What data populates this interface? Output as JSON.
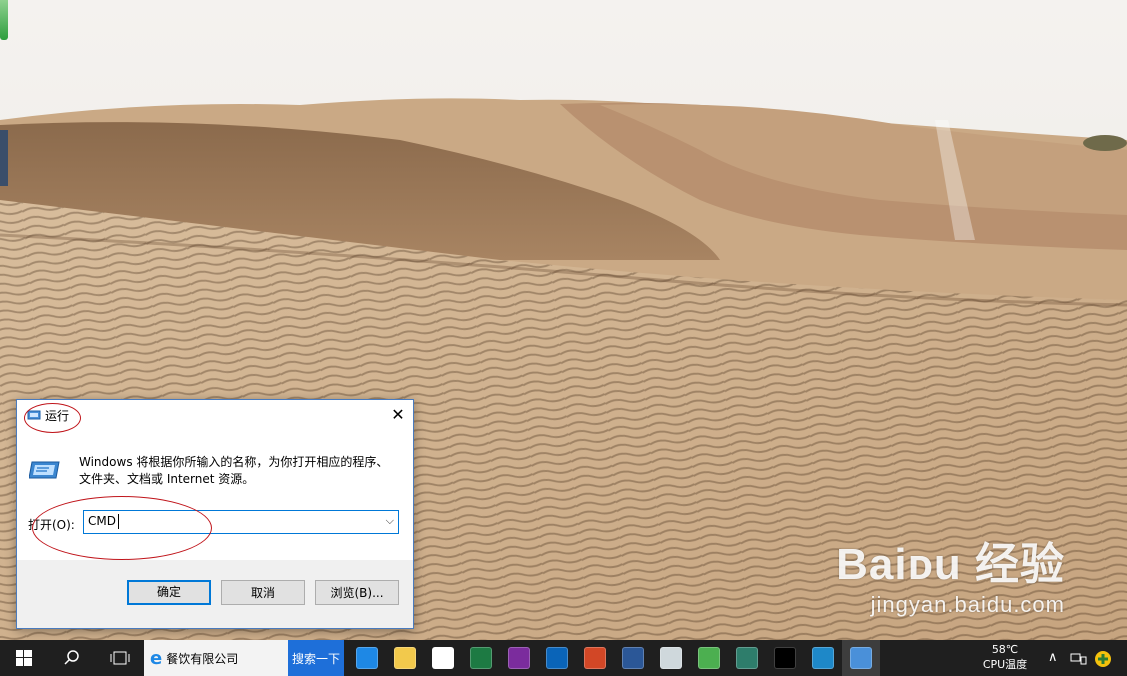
{
  "dialog": {
    "title": "运行",
    "close_glyph": "✕",
    "description": "Windows 将根据你所输入的名称，为你打开相应的程序、文件夹、文档或 Internet 资源。",
    "open_label": "打开(O):",
    "open_value": "CMD",
    "dropdown_glyph": "⌵",
    "ok_label": "确定",
    "cancel_label": "取消",
    "browse_label": "浏览(B)..."
  },
  "watermark": {
    "brand": "Baiᴅu 经验",
    "url": "jingyan.baidu.com"
  },
  "taskbar": {
    "ie_label": "餐饮有限公司",
    "search_label": "搜索一下",
    "temperature": "58℃",
    "cpu_label": "CPU温度",
    "items": [
      {
        "icon": "edge-icon",
        "color": "#1e88e5"
      },
      {
        "icon": "file-explorer-icon",
        "color": "#f2c94c"
      },
      {
        "icon": "store-icon",
        "color": "#ffffff"
      },
      {
        "icon": "excel-icon",
        "color": "#1d7a43"
      },
      {
        "icon": "onenote-icon",
        "color": "#7b2c9d"
      },
      {
        "icon": "outlook-icon",
        "color": "#0a64b8"
      },
      {
        "icon": "powerpoint-icon",
        "color": "#d24726"
      },
      {
        "icon": "word-icon",
        "color": "#2b5797"
      },
      {
        "icon": "paint-icon",
        "color": "#cfd8dc"
      },
      {
        "icon": "browser-icon",
        "color": "#4caf50"
      },
      {
        "icon": "photos-icon",
        "color": "#2e7d6b"
      },
      {
        "icon": "cmd-icon",
        "color": "#000000"
      },
      {
        "icon": "settings-icon",
        "color": "#1e88c8"
      },
      {
        "icon": "run-icon",
        "color": "#4a90d9"
      }
    ]
  }
}
